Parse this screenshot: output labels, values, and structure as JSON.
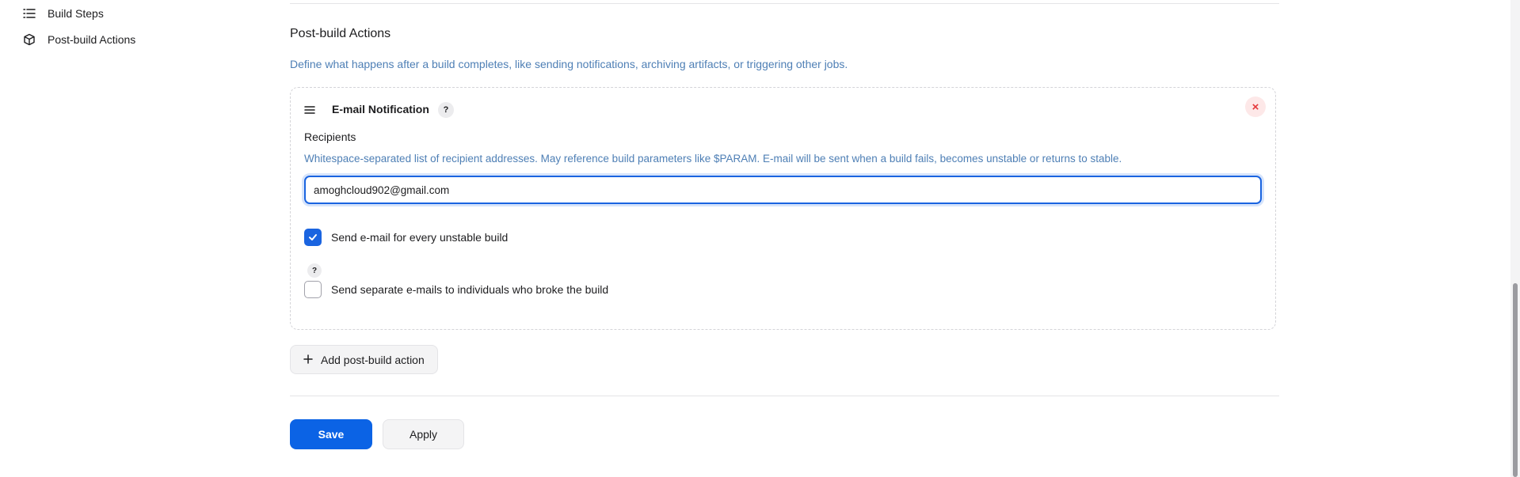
{
  "sidebar": {
    "items": [
      {
        "label": "Build Steps",
        "icon": "list-icon"
      },
      {
        "label": "Post-build Actions",
        "icon": "cube-icon"
      }
    ]
  },
  "section": {
    "title": "Post-build Actions",
    "description": "Define what happens after a build completes, like sending notifications, archiving artifacts, or triggering other jobs."
  },
  "email_notification": {
    "title": "E-mail Notification",
    "help": "?",
    "close": "×",
    "recipients": {
      "label": "Recipients",
      "description": "Whitespace-separated list of recipient addresses. May reference build parameters like $PARAM. E-mail will be sent when a build fails, becomes unstable or returns to stable.",
      "value": "amoghcloud902@gmail.com"
    },
    "unstable_option": {
      "label": "Send e-mail for every unstable build",
      "checked": true
    },
    "separate_option": {
      "label": "Send separate e-mails to individuals who broke the build",
      "checked": false,
      "help": "?"
    }
  },
  "add_action": {
    "label": "Add post-build action"
  },
  "buttons": {
    "save": "Save",
    "apply": "Apply"
  },
  "colors": {
    "accent": "#0b63e5",
    "link_text": "#4e7fb5",
    "danger": "#e5383b"
  }
}
